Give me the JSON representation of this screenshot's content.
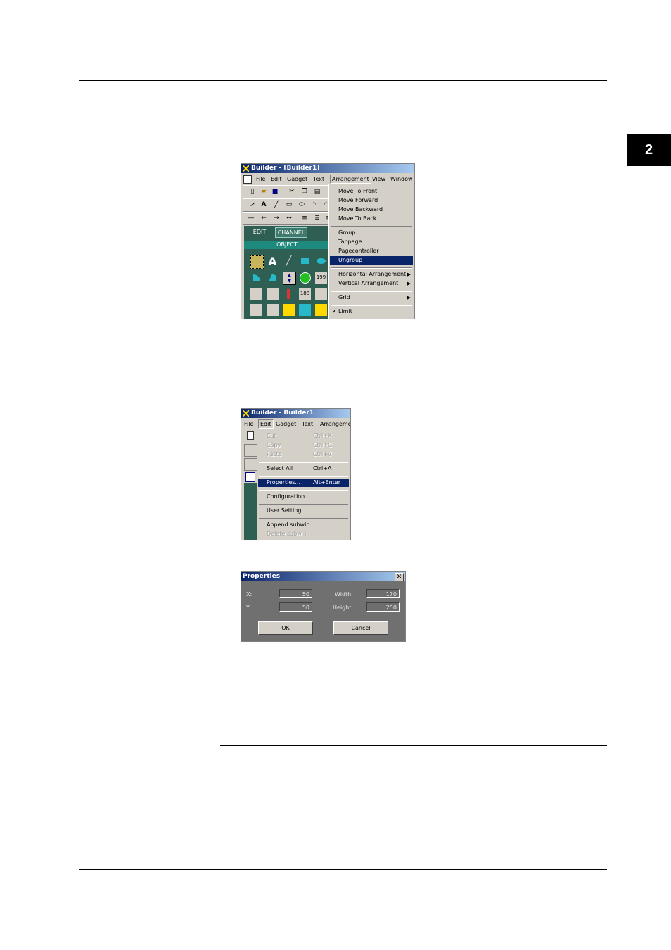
{
  "page": {
    "chapter_number": "2"
  },
  "screenshot1": {
    "title": "Builder - [Builder1]",
    "menubar": [
      "File",
      "Edit",
      "Gadget",
      "Text",
      "Arrangement",
      "View",
      "Window"
    ],
    "tabs": [
      "EDIT",
      "CHANNEL"
    ],
    "object_header": "OBJECT",
    "menu_items": {
      "move_to_front": "Move To Front",
      "move_forward": "Move Forward",
      "move_backward": "Move Backward",
      "move_to_back": "Move To Back",
      "group": "Group",
      "tabpage": "Tabpage",
      "pagecontroller": "Pagecontroller",
      "ungroup": "Ungroup",
      "horizontal": "Horizontal Arrangement",
      "vertical": "Vertical Arrangement",
      "grid": "Grid",
      "limit": "Limit"
    }
  },
  "screenshot2": {
    "title": "Builder - Builder1",
    "menubar": [
      "File",
      "Edit",
      "Gadget",
      "Text",
      "Arrangemer"
    ],
    "menu_items": {
      "cut": "Cut",
      "cut_sc": "Ctrl+X",
      "copy": "Copy",
      "copy_sc": "Ctrl+C",
      "paste": "Paste",
      "paste_sc": "Ctrl+V",
      "select_all": "Select All",
      "select_all_sc": "Ctrl+A",
      "properties": "Properties...",
      "properties_sc": "Alt+Enter",
      "configuration": "Configuration...",
      "user_setting": "User Setting...",
      "append_subwin": "Append subwin",
      "delete_subwin": "Delete subwin"
    }
  },
  "properties_dialog": {
    "title": "Properties",
    "x_label": "X:",
    "x_value": "50",
    "y_label": "Y:",
    "y_value": "50",
    "width_label": "Width",
    "width_value": "170",
    "height_label": "Height",
    "height_value": "250",
    "ok": "OK",
    "cancel": "Cancel"
  }
}
